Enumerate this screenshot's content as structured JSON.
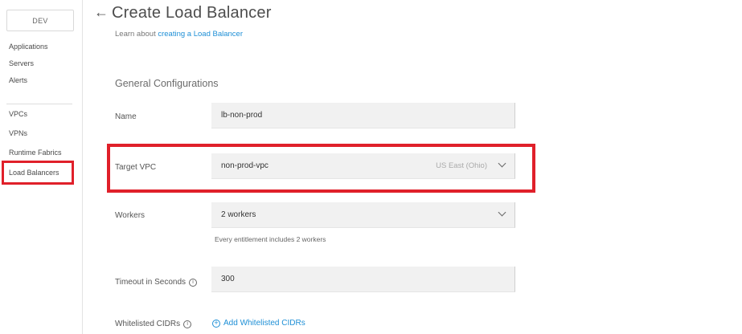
{
  "sidebar": {
    "environment": "DEV",
    "items": [
      "Applications",
      "Servers",
      "Alerts",
      "VPCs",
      "VPNs",
      "Runtime Fabrics",
      "Load Balancers"
    ],
    "selected": "Load Balancers"
  },
  "header": {
    "back_icon": "←",
    "title": "Create Load Balancer",
    "learn_prefix": "Learn about ",
    "learn_link": "creating a Load Balancer"
  },
  "section": {
    "title": "General Configurations"
  },
  "form": {
    "name": {
      "label": "Name",
      "value": "lb-non-prod"
    },
    "target_vpc": {
      "label": "Target VPC",
      "value": "non-prod-vpc",
      "region": "US East (Ohio)"
    },
    "workers": {
      "label": "Workers",
      "value": "2 workers",
      "hint": "Every entitlement includes 2 workers"
    },
    "timeout": {
      "label": "Timeout in Seconds",
      "value": "300",
      "info_icon": "ⓘ"
    },
    "whitelisted": {
      "label": "Whitelisted CIDRs",
      "info_icon": "ⓘ",
      "add_label": "Add Whitelisted CIDRs"
    }
  },
  "colors": {
    "highlight": "#e0202a",
    "link": "#1e8fd6",
    "input_bg": "#f1f1f1"
  }
}
